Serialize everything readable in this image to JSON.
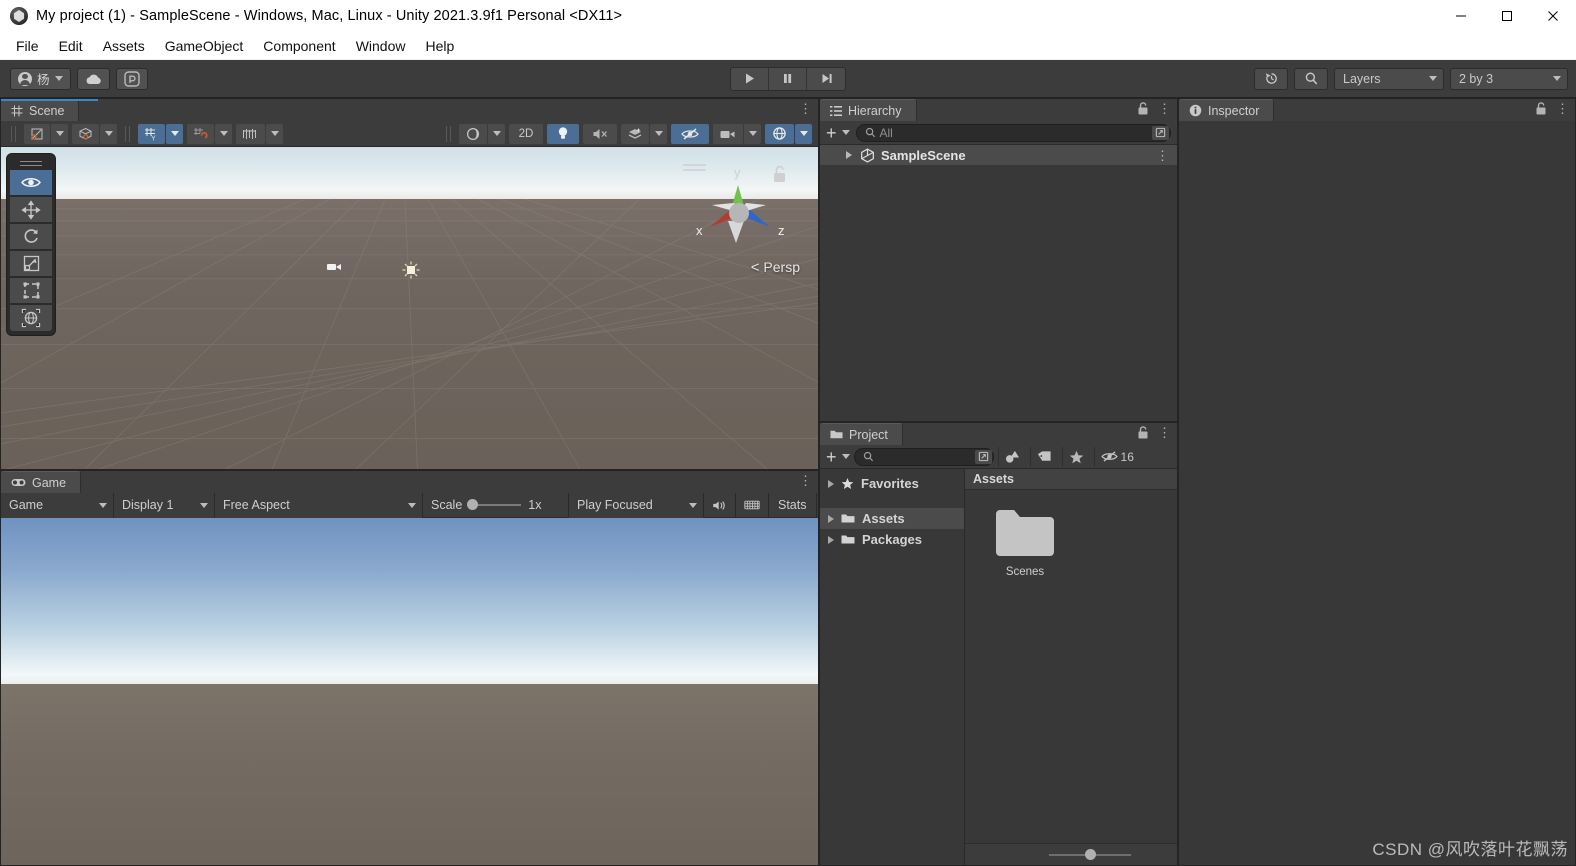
{
  "window": {
    "title": "My project (1) - SampleScene - Windows, Mac, Linux - Unity 2021.3.9f1 Personal <DX11>",
    "logo_icon": "unity-logo-icon",
    "controls": [
      {
        "name": "minimize",
        "icon": "minimize-icon"
      },
      {
        "name": "maximize",
        "icon": "maximize-icon"
      },
      {
        "name": "close",
        "icon": "close-icon"
      }
    ]
  },
  "menubar": {
    "items": [
      {
        "label": "File"
      },
      {
        "label": "Edit"
      },
      {
        "label": "Assets"
      },
      {
        "label": "GameObject"
      },
      {
        "label": "Component"
      },
      {
        "label": "Window"
      },
      {
        "label": "Help"
      }
    ]
  },
  "toolbar": {
    "account_label": "杨",
    "account_icon": "user-avatar-icon",
    "cloud_icon": "cloud-icon",
    "collab_icon": "unity-services-icon",
    "play_icon": "play-icon",
    "pause_icon": "pause-icon",
    "step_icon": "step-icon",
    "history_icon": "undo-history-icon",
    "search_icon": "search-icon",
    "layers_label": "Layers",
    "layout_label": "2 by 3"
  },
  "scene": {
    "tab_label": "Scene",
    "tab_icon": "scene-grid-icon",
    "lock_icon": "lock-icon",
    "menu_icon": "kebab-menu-icon",
    "toolbar": {
      "pivot_icon": "pivot-center-icon",
      "handle_icon": "global-local-handle-icon",
      "grid_icon": "grid-axis-y-icon",
      "snap_icon": "grid-snapping-icon",
      "snap_increment_icon": "snap-increment-icon",
      "shading_icon": "draw-mode-icon",
      "twod_label": "2D",
      "light_icon": "scene-lighting-icon",
      "audio_icon": "scene-audio-mute-icon",
      "fx_icon": "scene-effects-icon",
      "hidden_icon": "scene-visibility-icon",
      "camera_icon": "scene-camera-icon",
      "gizmos_icon": "gizmos-icon"
    },
    "tools": [
      {
        "name": "view-tool",
        "icon": "eye-icon",
        "active": true
      },
      {
        "name": "move-tool",
        "icon": "move-arrows-icon",
        "active": false
      },
      {
        "name": "rotate-tool",
        "icon": "rotate-icon",
        "active": false
      },
      {
        "name": "scale-tool",
        "icon": "scale-icon",
        "active": false
      },
      {
        "name": "rect-tool",
        "icon": "rect-transform-icon",
        "active": false
      },
      {
        "name": "transform-tool",
        "icon": "transform-icon",
        "active": false
      }
    ],
    "gizmo": {
      "x_label": "x",
      "y_label": "y",
      "z_label": "z",
      "persp_label": "Persp",
      "lock_icon": "gizmo-lock-icon"
    }
  },
  "game": {
    "tab_label": "Game",
    "tab_icon": "gamepad-icon",
    "menu_icon": "kebab-menu-icon",
    "target_label": "Game",
    "display_label": "Display 1",
    "aspect_label": "Free Aspect",
    "scale_label": "Scale",
    "scale_value": "1x",
    "play_mode_label": "Play Focused",
    "mute_icon": "mute-audio-icon",
    "stats_grid_icon": "gizmos-grid-icon",
    "stats_label": "Stats"
  },
  "hierarchy": {
    "tab_label": "Hierarchy",
    "tab_icon": "hierarchy-icon",
    "lock_icon": "lock-icon",
    "menu_icon": "kebab-menu-icon",
    "add_icon": "plus-icon",
    "search_placeholder": "All",
    "search_icon": "search-icon",
    "search_expand_icon": "search-expand-icon",
    "rows": [
      {
        "label": "SampleScene",
        "icon": "unity-scene-icon",
        "menu_icon": "kebab-menu-icon"
      }
    ]
  },
  "project": {
    "tab_label": "Project",
    "tab_icon": "folder-icon",
    "lock_icon": "lock-icon",
    "menu_icon": "kebab-menu-icon",
    "add_icon": "plus-icon",
    "search_placeholder": "",
    "search_icon": "search-icon",
    "search_expand_icon": "search-expand-icon",
    "filter_type_icon": "filter-by-type-icon",
    "filter_label_icon": "filter-by-label-icon",
    "favorites_icon": "star-icon",
    "hidden_icon": "scene-visibility-icon",
    "hidden_count": "16",
    "tree": [
      {
        "label": "Favorites",
        "icon": "star-icon",
        "selected": false
      },
      {
        "label": "Assets",
        "icon": "folder-icon",
        "selected": true
      },
      {
        "label": "Packages",
        "icon": "folder-icon",
        "selected": false
      }
    ],
    "breadcrumb": "Assets",
    "assets": [
      {
        "label": "Scenes",
        "icon": "folder-icon"
      }
    ]
  },
  "inspector": {
    "tab_label": "Inspector",
    "tab_icon": "info-icon",
    "lock_icon": "lock-icon",
    "menu_icon": "kebab-menu-icon"
  },
  "watermark": {
    "text": "CSDN @风吹落叶花飘荡"
  }
}
